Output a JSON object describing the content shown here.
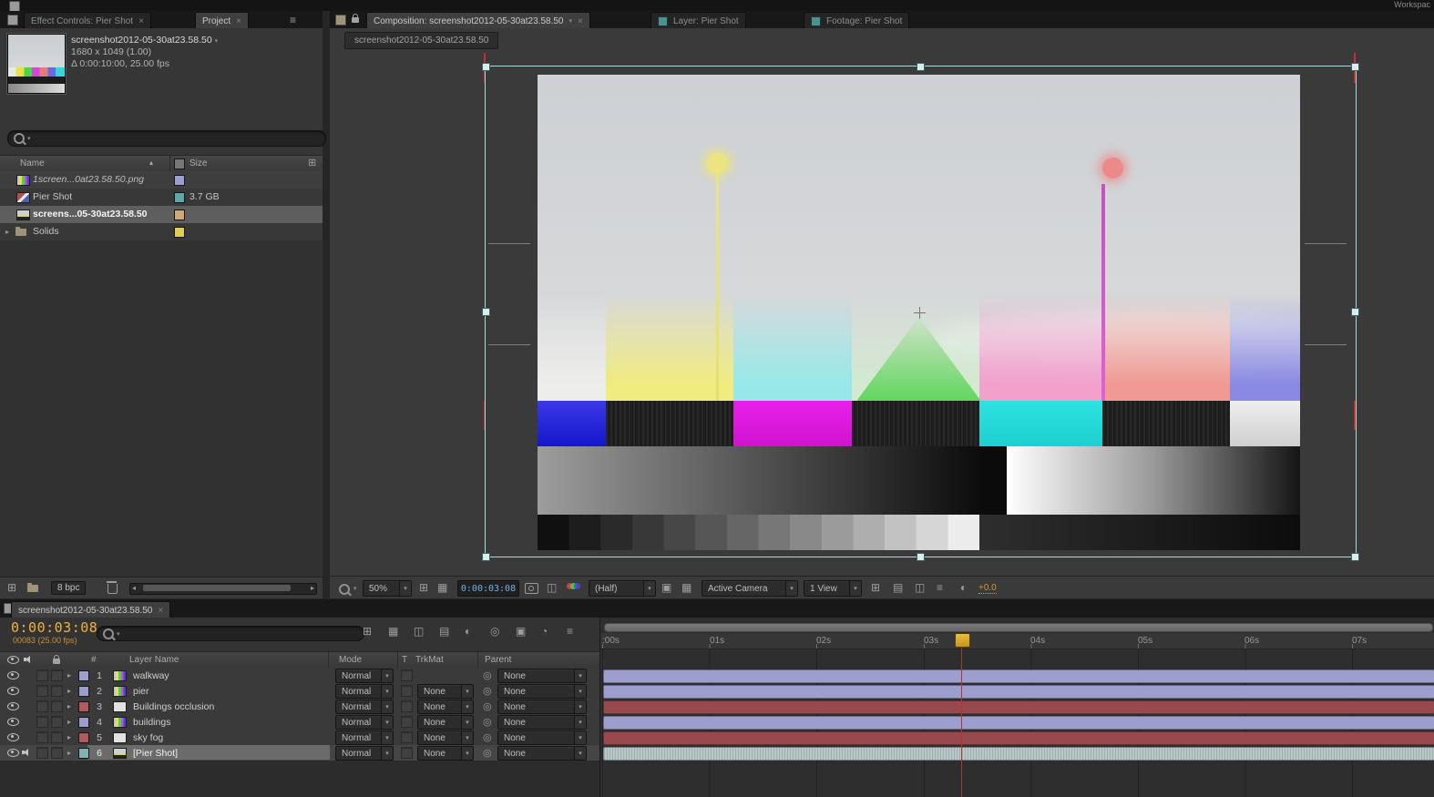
{
  "glyphs": {
    "dropdown": "▾",
    "disclosure": "▸",
    "close": "×",
    "menu": "≡",
    "sort_asc": "▴",
    "scroll_left": "◂",
    "scroll_right": "▸",
    "pickwhip": "◎",
    "grid": "⊞",
    "checker": "▦",
    "panel": "◫",
    "rows": "▤",
    "roi": "▣",
    "half_circle": "◐",
    "clock": "◔"
  },
  "colors": {
    "label_lavender": "#9d9ecd",
    "label_red": "#98494d",
    "label_teal": "#b8c7c7",
    "timecode_orange": "#f2b13e",
    "timecode_blue": "#74b2e2",
    "selection_cyan": "#a9d8d8",
    "playhead_yellow": "#d8a520"
  },
  "top": {
    "workspace": "Workspac",
    "left_tabs": [
      {
        "label": "Effect Controls: Pier Shot"
      },
      {
        "label": "Project"
      }
    ],
    "right_tabs": [
      {
        "label": "Composition: screenshot2012-05-30at23.58.50"
      },
      {
        "label": "Layer: Pier Shot"
      },
      {
        "label": "Footage: Pier Shot"
      }
    ]
  },
  "project": {
    "title": "screenshot2012-05-30at23.58.50",
    "dimensions": "1680 x 1049 (1.00)",
    "duration": "Δ 0:00:10:00, 25.00 fps",
    "columns": {
      "name": "Name",
      "size": "Size"
    },
    "rows": [
      {
        "name": "1screen...0at23.58.50.png",
        "size": ""
      },
      {
        "name": "Pier Shot",
        "size": "3.7 GB"
      },
      {
        "name": "screens...05-30at23.58.50",
        "size": ""
      },
      {
        "name": "Solids",
        "size": ""
      }
    ],
    "footer": {
      "bpc": "8 bpc"
    }
  },
  "viewer": {
    "comp_tab": "screenshot2012-05-30at23.58.50",
    "zoom": "50%",
    "timecode": "0:00:03:08",
    "resolution": "(Half)",
    "camera": "Active Camera",
    "view": "1 View",
    "exposure": "+0.0"
  },
  "timeline": {
    "tab": "screenshot2012-05-30at23.58.50",
    "timecode": "0:00:03:08",
    "frame_info": "00083 (25.00 fps)",
    "headers": {
      "num": "#",
      "layer_name": "Layer Name",
      "mode": "Mode",
      "t": "T",
      "trkmat": "TrkMat",
      "parent": "Parent"
    },
    "ruler": [
      ":00s",
      "01s",
      "02s",
      "03s",
      "04s",
      "05s",
      "06s",
      "07s"
    ],
    "layers": [
      {
        "num": "1",
        "name": "walkway",
        "mode": "Normal",
        "trkmat": "",
        "parent": "None"
      },
      {
        "num": "2",
        "name": "pier",
        "mode": "Normal",
        "trkmat": "None",
        "parent": "None"
      },
      {
        "num": "3",
        "name": "Buildings occlusion",
        "mode": "Normal",
        "trkmat": "None",
        "parent": "None"
      },
      {
        "num": "4",
        "name": "buildings",
        "mode": "Normal",
        "trkmat": "None",
        "parent": "None"
      },
      {
        "num": "5",
        "name": "sky fog",
        "mode": "Normal",
        "trkmat": "None",
        "parent": "None"
      },
      {
        "num": "6",
        "name": "[Pier Shot]",
        "mode": "Normal",
        "trkmat": "None",
        "parent": "None"
      }
    ]
  }
}
